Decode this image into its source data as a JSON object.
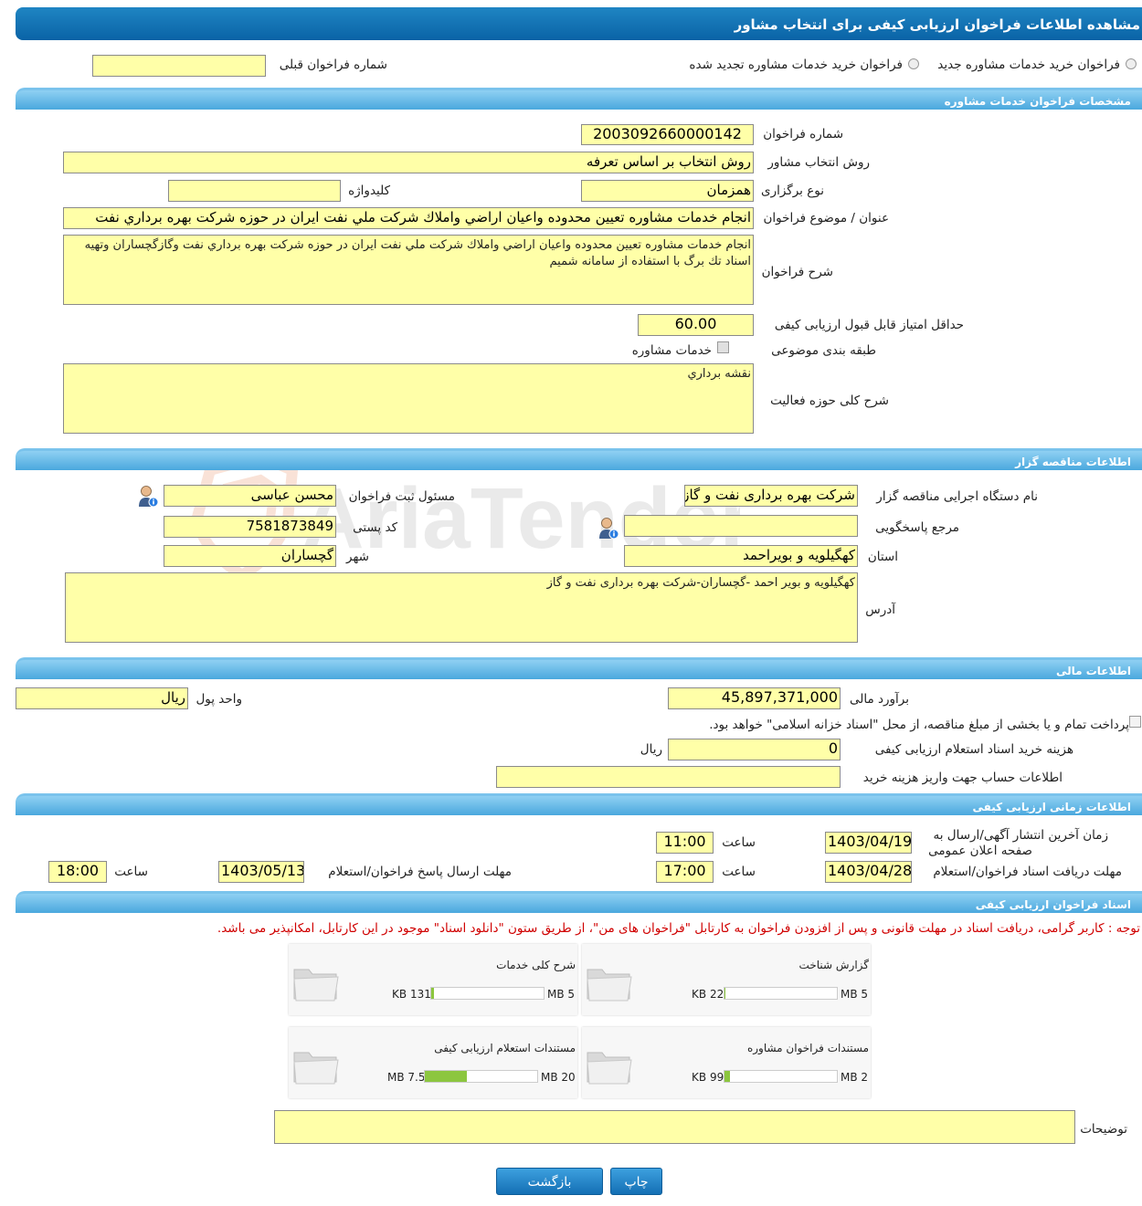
{
  "header": {
    "title": "مشاهده اطلاعات فراخوان ارزیابی کیفی برای انتخاب مشاور"
  },
  "type_options": {
    "new": "فراخوان خرید خدمات مشاوره جدید",
    "renewed": "فراخوان خرید خدمات مشاوره تجدید شده",
    "previous_label": "شماره فراخوان قبلی",
    "previous_value": ""
  },
  "sections": {
    "consultant": "مشخصات فراخوان خدمات مشاوره",
    "organizer": "اطلاعات مناقصه گزار",
    "finance": "اطلاعات مالی",
    "timing": "اطلاعات زمانی ارزیابی کیفی",
    "documents": "اسناد فراخوان ارزیابی کیفی"
  },
  "consultant": {
    "number_label": "شماره فراخوان",
    "number": "2003092660000142",
    "method_label": "روش انتخاب مشاور",
    "method": "روش انتخاب بر اساس تعرفه",
    "holding_label": "نوع برگزاری",
    "holding": "همزمان",
    "keyword_label": "کلیدواژه",
    "keyword": "",
    "subject_label": "عنوان / موضوع فراخوان",
    "subject": "انجام خدمات مشاوره تعيين محدوده واعيان اراضي واملاك شركت ملي نفت ايران در حوزه شركت بهره برداري نفت",
    "desc_label": "شرح فراخوان",
    "desc": "انجام خدمات مشاوره تعيين محدوده واعيان اراضي واملاك شركت ملي نفت ايران در حوزه شركت بهره برداري نفت وگازگچساران وتهيه اسناد تك برگ با استفاده از سامانه شميم",
    "min_score_label": "حداقل امتیاز قابل قبول ارزیابی کیفی",
    "min_score": "60.00",
    "category_label": "طبقه بندی موضوعی",
    "category": "خدمات مشاوره",
    "activity_label": "شرح کلی حوزه فعالیت",
    "activity": "نقشه برداري"
  },
  "organizer": {
    "org_label": "نام دستگاه اجرایی مناقصه گزار",
    "org": "شرکت بهره برداری نفت و گاز گچساران",
    "registrar_label": "مسئول ثبت فراخوان",
    "registrar": "محسن  عباسی",
    "reference_label": "مرجع پاسخگویی",
    "reference": "",
    "postal_label": "کد پستی",
    "postal": "7581873849",
    "province_label": "استان",
    "province": "کهگیلویه و بویراحمد",
    "city_label": "شهر",
    "city": "گچساران",
    "address_label": "آدرس",
    "address": "كهگيلويه و بوير احمد -گچساران-شرکت بهره برداری نفت و گاز"
  },
  "finance": {
    "estimate_label": "برآورد مالی",
    "estimate": "45,897,371,000",
    "currency_label": "واحد پول",
    "currency": "ریال",
    "treasury_text": "پرداخت تمام و یا بخشی از مبلغ مناقصه، از محل \"اسناد خزانه اسلامی\" خواهد بود.",
    "fee_label": "هزینه خرید اسناد استعلام ارزیابی کیفی",
    "fee": "0",
    "fee_unit": "ریال",
    "account_label": "اطلاعات حساب جهت واریز هزینه خرید",
    "account": ""
  },
  "timing": {
    "publish_label_1": "زمان آخرین انتشار آگهی/ارسال به",
    "publish_label_2": "صفحه اعلان عمومی",
    "publish_date": "1403/04/19",
    "hour_label": "ساعت",
    "publish_time": "11:00",
    "receive_label": "مهلت دریافت اسناد فراخوان/استعلام",
    "receive_date": "1403/04/28",
    "receive_time": "17:00",
    "submit_label": "مهلت ارسال پاسخ فراخوان/استعلام",
    "submit_date": "1403/05/13",
    "submit_time": "18:00"
  },
  "documents": {
    "notice": "توجه : کاربر گرامی، دریافت اسناد در مهلت قانونی و پس از افزودن فراخوان به کارتابل \"فراخوان های من\"، از طریق ستون \"دانلود اسناد\" موجود در این کارتابل، امکانپذیر می باشد.",
    "items": [
      {
        "name": "گزارش شناخت",
        "size": "22 KB",
        "max": "5 MB",
        "fraction": 0.004
      },
      {
        "name": "شرح کلی خدمات",
        "size": "131 KB",
        "max": "5 MB",
        "fraction": 0.026
      },
      {
        "name": "مستندات فراخوان مشاوره",
        "size": "99 KB",
        "max": "2 MB",
        "fraction": 0.05
      },
      {
        "name": "مستندات استعلام ارزیابی کیفی",
        "size": "7.5 MB",
        "max": "20 MB",
        "fraction": 0.375
      }
    ],
    "notes_label": "توضیحات",
    "notes": ""
  },
  "buttons": {
    "print": "چاپ",
    "back": "بازگشت"
  },
  "colors": {
    "header": "#0a63a6",
    "section": "#4aa8de",
    "field": "#ffffa8",
    "notice": "#d00000",
    "progress": "#8cc63f"
  }
}
